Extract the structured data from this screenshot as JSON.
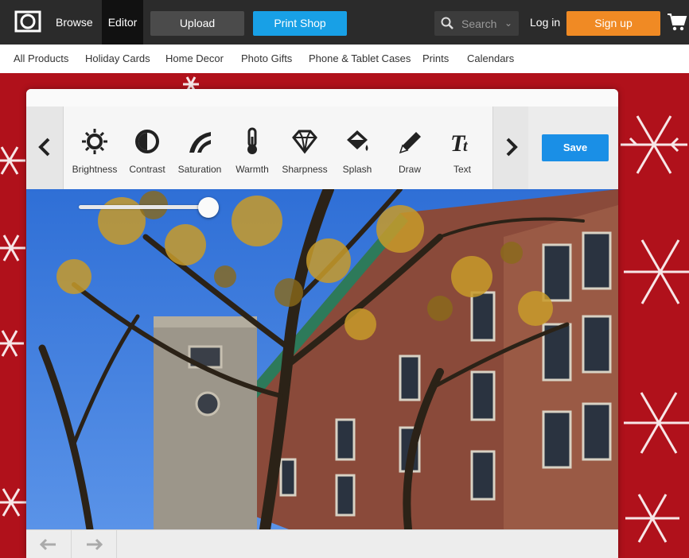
{
  "topbar": {
    "browse": "Browse",
    "editor": "Editor",
    "upload": "Upload",
    "print_shop": "Print Shop",
    "search_placeholder": "Search",
    "login": "Log in",
    "signup": "Sign up"
  },
  "subnav": [
    "All Products",
    "Holiday Cards",
    "Home Decor",
    "Photo Gifts",
    "Phone & Tablet Cases",
    "Prints",
    "Calendars"
  ],
  "toolbar": {
    "tools": [
      {
        "label": "Brightness",
        "icon": "brightness-icon"
      },
      {
        "label": "Contrast",
        "icon": "contrast-icon"
      },
      {
        "label": "Saturation",
        "icon": "saturation-icon"
      },
      {
        "label": "Warmth",
        "icon": "thermometer-icon"
      },
      {
        "label": "Sharpness",
        "icon": "diamond-icon"
      },
      {
        "label": "Splash",
        "icon": "paint-bucket-icon"
      },
      {
        "label": "Draw",
        "icon": "pencil-icon"
      },
      {
        "label": "Text",
        "icon": "text-icon"
      }
    ],
    "save": "Save"
  },
  "colors": {
    "topbar": "#2b2b2b",
    "print_shop": "#18a0e6",
    "signup": "#f08a24",
    "save": "#1a8fe6",
    "holiday_red": "#b0111b"
  }
}
